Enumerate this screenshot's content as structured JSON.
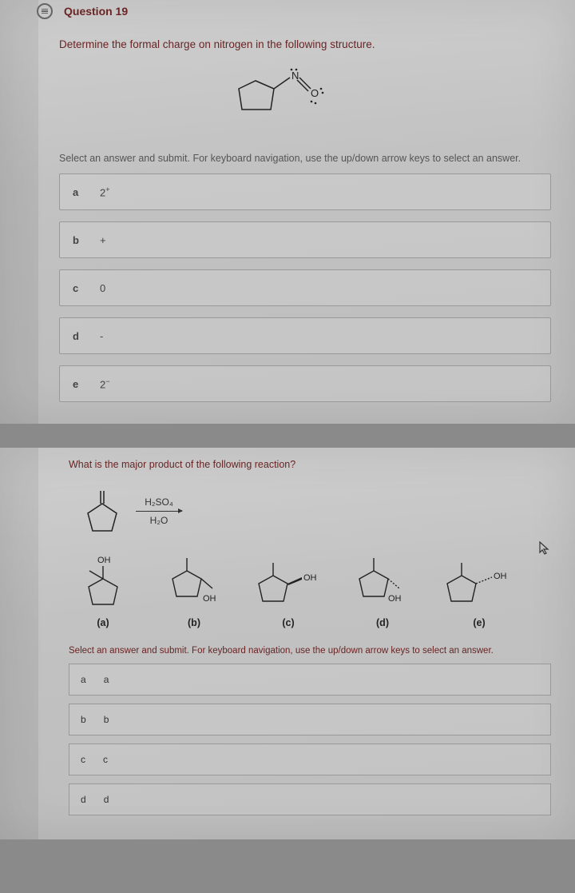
{
  "q1": {
    "header": "Question 19",
    "prompt": "Determine the formal charge on nitrogen in the following structure.",
    "instructions": "Select an answer and submit. For keyboard navigation, use the up/down arrow keys to select an answer.",
    "choices": [
      {
        "key": "a",
        "val": "2⁺"
      },
      {
        "key": "b",
        "val": "+"
      },
      {
        "key": "c",
        "val": "0"
      },
      {
        "key": "d",
        "val": "-"
      },
      {
        "key": "e",
        "val": "2⁻"
      }
    ],
    "structure_labels": {
      "n": "N",
      "o": "O"
    }
  },
  "q2": {
    "prompt": "What is the major product of the following reaction?",
    "reagent_top": "H₂SO₄",
    "reagent_bot": "H₂O",
    "oh_label": "OH",
    "options": [
      {
        "label": "(a)"
      },
      {
        "label": "(b)"
      },
      {
        "label": "(c)"
      },
      {
        "label": "(d)"
      },
      {
        "label": "(e)"
      }
    ],
    "instructions": "Select an answer and submit. For keyboard navigation, use the up/down arrow keys to select an answer.",
    "choices": [
      {
        "key": "a",
        "val": "a"
      },
      {
        "key": "b",
        "val": "b"
      },
      {
        "key": "c",
        "val": "c"
      },
      {
        "key": "d",
        "val": "d"
      }
    ]
  }
}
